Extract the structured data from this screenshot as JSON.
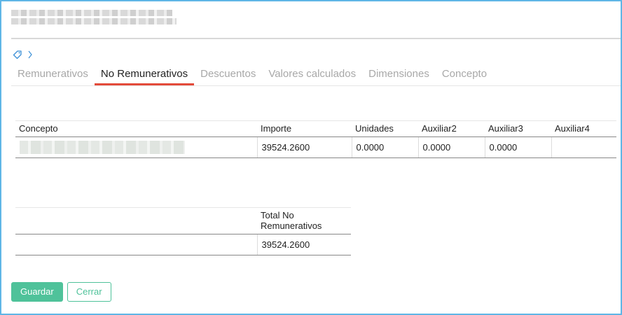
{
  "tabs": [
    {
      "label": "Remunerativos",
      "active": false
    },
    {
      "label": "No Remunerativos",
      "active": true
    },
    {
      "label": "Descuentos",
      "active": false
    },
    {
      "label": "Valores calculados",
      "active": false
    },
    {
      "label": "Dimensiones",
      "active": false
    },
    {
      "label": "Concepto",
      "active": false
    }
  ],
  "detail_table": {
    "headers": [
      "Concepto",
      "Importe",
      "Unidades",
      "Auxiliar2",
      "Auxiliar3",
      "Auxiliar4"
    ],
    "rows": [
      {
        "importe": "39524.2600",
        "unidades": "0.0000",
        "auxiliar2": "0.0000",
        "auxiliar3": "0.0000",
        "auxiliar4": ""
      }
    ]
  },
  "total_table": {
    "header": "Total No Remunerativos",
    "value": "39524.2600"
  },
  "buttons": {
    "save": "Guardar",
    "close": "Cerrar"
  },
  "colors": {
    "accent": "#4fc29a",
    "active_tab_underline": "#e34a3a",
    "frame_border": "#5fb6e6"
  }
}
